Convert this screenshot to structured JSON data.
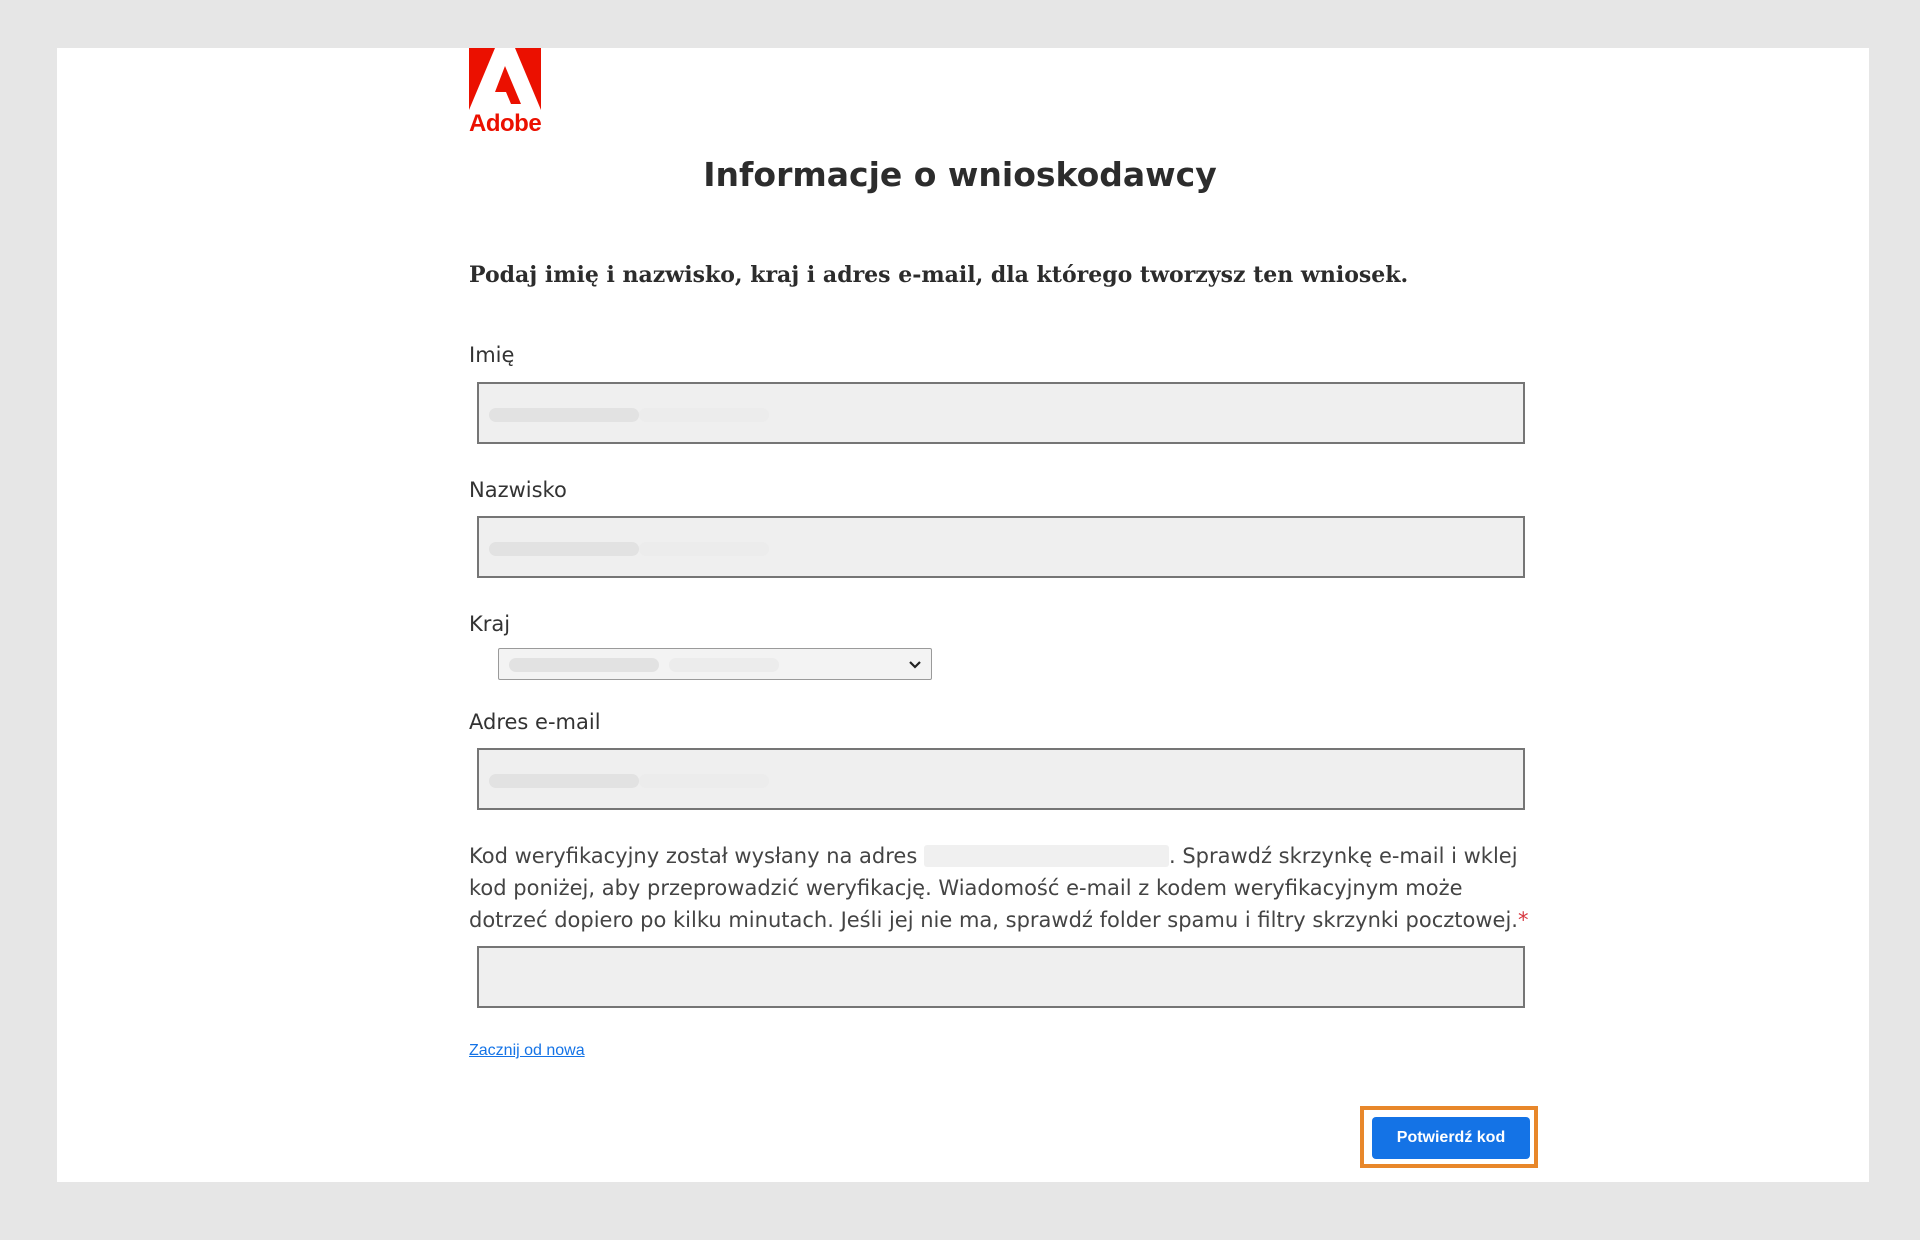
{
  "brand": {
    "name": "Adobe",
    "color": "#eb1000",
    "icon": "adobe-logo-icon"
  },
  "page": {
    "title": "Informacje o wnioskodawcy",
    "intro": "Podaj imię i nazwisko, kraj i adres e-mail, dla którego tworzysz ten wniosek."
  },
  "form": {
    "first_name": {
      "label": "Imię",
      "value": ""
    },
    "last_name": {
      "label": "Nazwisko",
      "value": ""
    },
    "country": {
      "label": "Kraj",
      "value": ""
    },
    "email": {
      "label": "Adres e-mail",
      "value": ""
    },
    "verification": {
      "text_before": "Kod weryfikacyjny został wysłany na adres",
      "text_after": ". Sprawdź skrzynkę e-mail i wklej kod poniżej, aby przeprowadzić weryfikację. Wiadomość e-mail z kodem weryfikacyjnym może dotrzeć dopiero po kilku minutach. Jeśli jej nie ma, sprawdź folder spamu i filtry skrzynki pocztowej.",
      "required_marker": "*",
      "code_value": ""
    }
  },
  "actions": {
    "restart_link": "Zacznij od nowa",
    "confirm_button": "Potwierdź kod"
  },
  "colors": {
    "accent": "#1473e6",
    "highlight": "#e8872a",
    "required": "#d7373f"
  }
}
